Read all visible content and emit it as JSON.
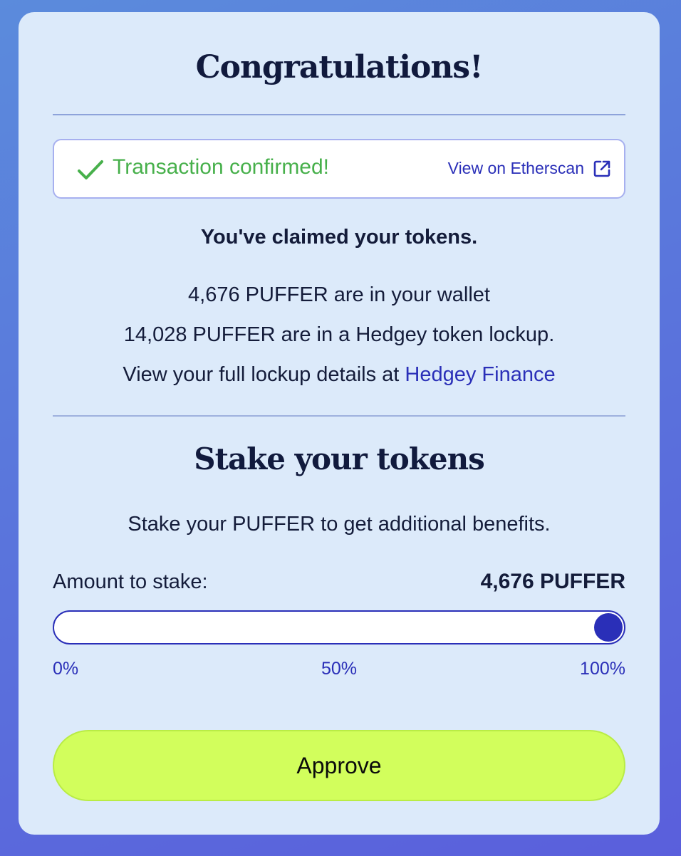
{
  "congrats_title": "Congratulations!",
  "confirmation": {
    "status_text": "Transaction confirmed!",
    "status_icon": "checkmark-icon",
    "link_label": "View on Etherscan",
    "link_icon": "external-link-icon"
  },
  "claimed": {
    "heading": "You've claimed your tokens.",
    "wallet_line": "4,676 PUFFER are in your wallet",
    "lockup_line": "14,028 PUFFER are in a Hedgey token lockup.",
    "details_prefix": "View your full lockup details at ",
    "details_link": "Hedgey Finance"
  },
  "stake": {
    "title": "Stake your tokens",
    "description": "Stake your PUFFER to get additional benefits.",
    "amount_label": "Amount to stake:",
    "amount_value": "4,676 PUFFER",
    "slider_percent": 100,
    "ticks": [
      "0%",
      "50%",
      "100%"
    ],
    "approve_label": "Approve"
  },
  "colors": {
    "accent": "#2a2fb8",
    "success": "#47b04b",
    "approve_bg": "#d2fe5c",
    "card_bg": "#dceafa"
  }
}
